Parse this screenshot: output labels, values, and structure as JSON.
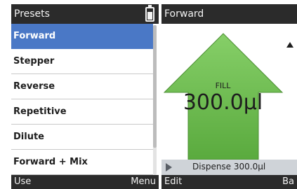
{
  "left_screen": {
    "title": "Presets",
    "items": [
      {
        "label": "Forward",
        "selected": true
      },
      {
        "label": "Stepper",
        "selected": false
      },
      {
        "label": "Reverse",
        "selected": false
      },
      {
        "label": "Repetitive",
        "selected": false
      },
      {
        "label": "Dilute",
        "selected": false
      },
      {
        "label": "Forward + Mix",
        "selected": false
      }
    ],
    "softkeys": {
      "left": "Use",
      "right": "Menu"
    },
    "battery_icon": "battery-icon"
  },
  "right_screen": {
    "title": "Forward",
    "arrow_color": "#6dbf4f",
    "fill_label": "FILL",
    "volume": "300.0µl",
    "dispense_text": "Dispense 300.0µl",
    "softkeys": {
      "left": "Edit",
      "right": "Ba"
    }
  },
  "colors": {
    "titlebar": "#2b2b2b",
    "selected": "#4a78c6",
    "arrow_fill": "#6dbf4f",
    "dispense_bar": "#cfd3d8"
  }
}
